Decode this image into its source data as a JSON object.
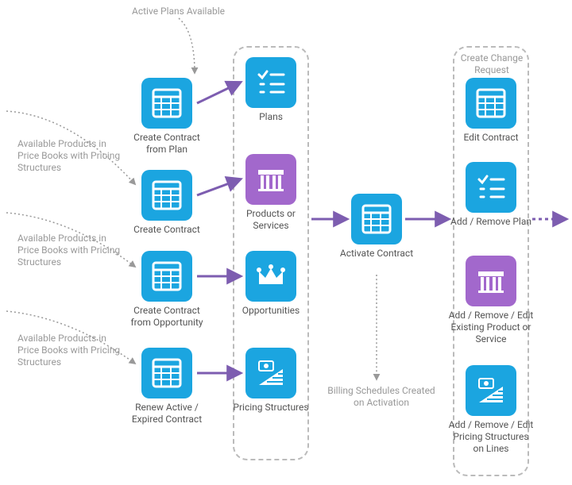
{
  "annotations": {
    "top": "Active Plans Available",
    "left1": "Available Products in Price Books with Pricing Structures",
    "left2": "Available Products in Price Books with Pricing Structures",
    "left3": "Available Products in Price Books with Pricing Structures",
    "billing": "Billing Schedules Created on Activation",
    "changeReq": "Create Change Request"
  },
  "col1": {
    "t1": "Create Contract from Plan",
    "t2": "Create Contract",
    "t3": "Create Contract from Opportunity",
    "t4": "Renew Active / Expired Contract"
  },
  "col2": {
    "t1": "Plans",
    "t2": "Products or Services",
    "t3": "Opportunities",
    "t4": "Pricing Structures"
  },
  "mid": {
    "activate": "Activate Contract"
  },
  "col3": {
    "t1": "Edit Contract",
    "t2": "Add / Remove Plan",
    "t3": "Add / Remove / Edit Existing Product or Service",
    "t4": "Add / Remove / Edit Pricing Structures on Lines"
  }
}
